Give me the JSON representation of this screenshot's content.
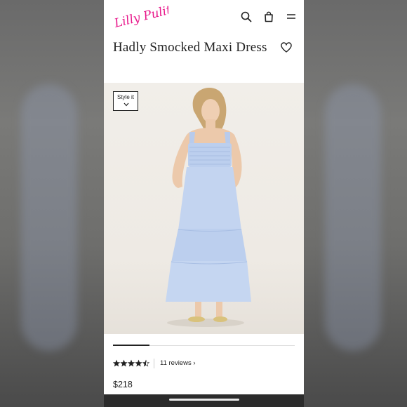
{
  "brand": {
    "logo_text": "Lilly Pulitzer",
    "logo_color": "#e8188b"
  },
  "header": {
    "icons": [
      "search-icon",
      "shopping-bag-icon",
      "menu-icon"
    ]
  },
  "product": {
    "title": "Hadly Smocked Maxi Dress",
    "wishlist_icon": "heart-icon",
    "style_it_label": "Style it",
    "gallery_progress": 0.2,
    "rating": 4.5,
    "rating_max": 5,
    "reviews_label": "11 reviews ›",
    "price": "$218"
  }
}
